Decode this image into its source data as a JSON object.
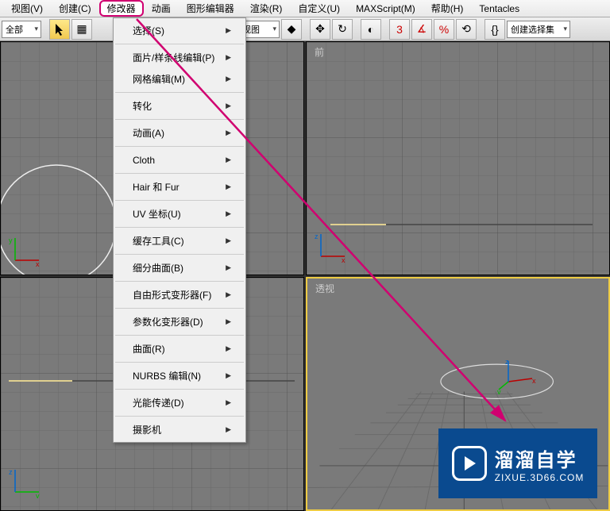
{
  "menubar": {
    "items": [
      "视图(V)",
      "创建(C)",
      "修改器",
      "动画",
      "图形编辑器",
      "渲染(R)",
      "自定义(U)",
      "MAXScript(M)",
      "帮助(H)",
      "Tentacles"
    ],
    "active_index": 2
  },
  "toolbar": {
    "left_combo": "全部",
    "view_combo": "视图",
    "selset_combo": "创建选择集"
  },
  "dropdown": {
    "items": [
      {
        "label": "选择(S)",
        "sub": true
      },
      {
        "sep": true
      },
      {
        "label": "面片/样条线编辑(P)",
        "sub": true
      },
      {
        "label": "网格编辑(M)",
        "sub": true
      },
      {
        "sep": true
      },
      {
        "label": "转化",
        "sub": true
      },
      {
        "sep": true
      },
      {
        "label": "动画(A)",
        "sub": true
      },
      {
        "sep": true
      },
      {
        "label": "Cloth",
        "sub": true
      },
      {
        "sep": true
      },
      {
        "label": "Hair 和 Fur",
        "sub": true
      },
      {
        "sep": true
      },
      {
        "label": "UV 坐标(U)",
        "sub": true
      },
      {
        "sep": true
      },
      {
        "label": "缓存工具(C)",
        "sub": true
      },
      {
        "sep": true
      },
      {
        "label": "细分曲面(B)",
        "sub": true
      },
      {
        "sep": true
      },
      {
        "label": "自由形式变形器(F)",
        "sub": true
      },
      {
        "sep": true
      },
      {
        "label": "参数化变形器(D)",
        "sub": true
      },
      {
        "sep": true
      },
      {
        "label": "曲面(R)",
        "sub": true
      },
      {
        "sep": true
      },
      {
        "label": "NURBS 编辑(N)",
        "sub": true
      },
      {
        "sep": true
      },
      {
        "label": "光能传递(D)",
        "sub": true
      },
      {
        "sep": true
      },
      {
        "label": "摄影机",
        "sub": true
      }
    ]
  },
  "viewports": {
    "top_left": "",
    "top_right": "前",
    "bottom_left": "",
    "bottom_right": "透视"
  },
  "watermark": {
    "title": "溜溜自学",
    "url": "ZIXUE.3D66.COM"
  },
  "axes": {
    "x": "x",
    "y": "y",
    "z": "z"
  }
}
